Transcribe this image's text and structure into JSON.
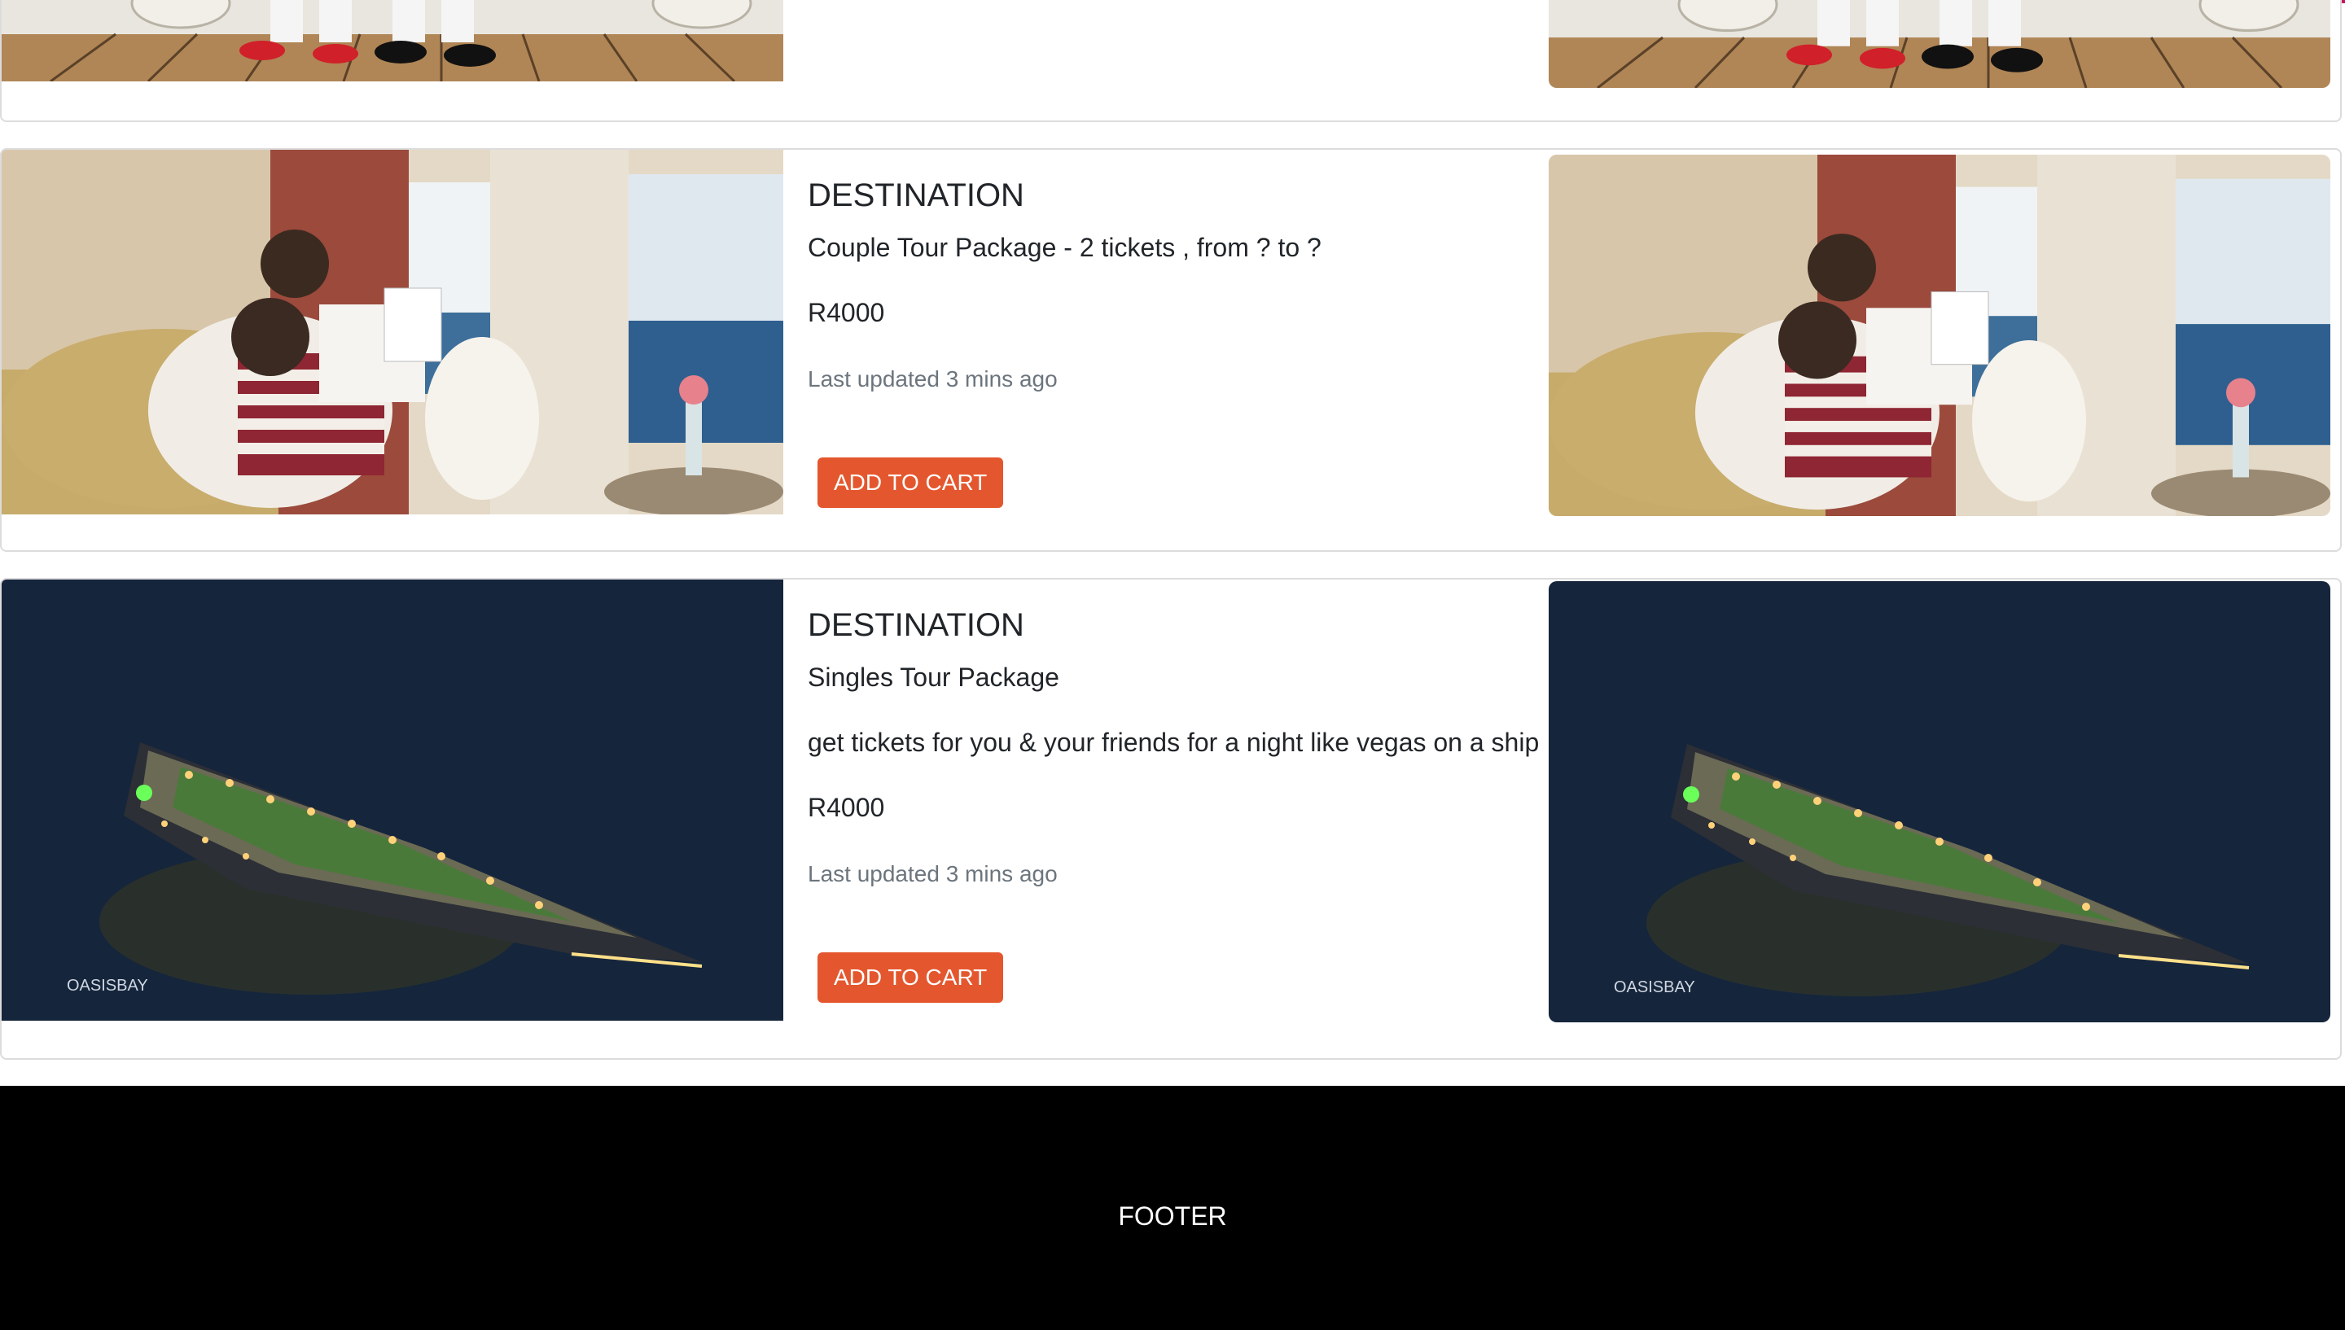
{
  "products": [
    {
      "image": "cruise-deck-dancers",
      "title": "",
      "description": "",
      "price": "",
      "updated": ""
    },
    {
      "image": "couple-reading-cabin",
      "title": "DESTINATION",
      "description": "Couple Tour Package - 2 tickets , from ? to ?",
      "price": "R4000",
      "updated": "Last updated 3 mins ago",
      "button": "ADD TO CART"
    },
    {
      "image": "cruise-ship-night-aerial",
      "title": "DESTINATION",
      "description": "Singles Tour Package",
      "tagline": "get tickets for you & your friends for a night like vegas on a ship",
      "price": "R4000",
      "updated": "Last updated 3 mins ago",
      "button": "ADD TO CART",
      "watermark": "OASISBAY"
    }
  ],
  "footer": {
    "label": "FOOTER"
  },
  "colors": {
    "accent": "#e4572e",
    "footer_bg": "#000000",
    "top_border": "#c2185b"
  }
}
